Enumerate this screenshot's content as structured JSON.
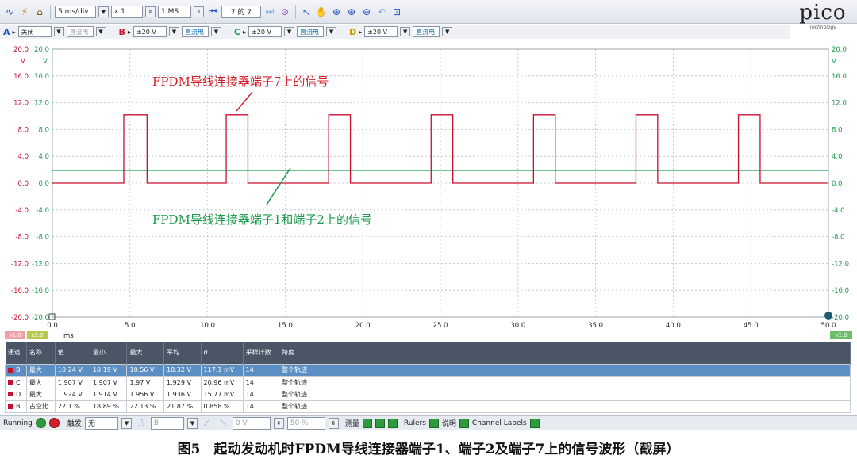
{
  "toolbar": {
    "timebase": "5 ms/div",
    "zoom": "x 1",
    "samples": "1 MS",
    "capture": "7 的 7"
  },
  "logo": {
    "text": "pico",
    "sub": "Technology"
  },
  "channels": [
    {
      "letter": "A",
      "range": "关闭",
      "coupling": "直流电",
      "enabled": false,
      "color": "#1f4fbf"
    },
    {
      "letter": "B",
      "range": "±20 V",
      "coupling": "直流电",
      "enabled": true,
      "color": "#c8102e"
    },
    {
      "letter": "C",
      "range": "±20 V",
      "coupling": "直流电",
      "enabled": true,
      "color": "#1a9a4a"
    },
    {
      "letter": "D",
      "range": "±20 V",
      "coupling": "直流电",
      "enabled": true,
      "color": "#c9a000"
    }
  ],
  "chart_data": {
    "type": "line",
    "xlabel": "ms",
    "xlim": [
      0,
      50
    ],
    "ylim": [
      -20,
      20
    ],
    "yunit": "V",
    "xticks": [
      "0.0",
      "5.0",
      "10.0",
      "15.0",
      "20.0",
      "25.0",
      "30.0",
      "35.0",
      "40.0",
      "45.0",
      "50.0"
    ],
    "yticks": [
      "20.0",
      "16.0",
      "12.0",
      "8.0",
      "4.0",
      "0.0",
      "-4.0",
      "-8.0",
      "-12.0",
      "-16.0",
      "-20.0"
    ],
    "series": [
      {
        "color": "#c8102e",
        "pulses_ms": [
          [
            4.6,
            6.1
          ],
          [
            11.2,
            12.6
          ],
          [
            17.8,
            19.2
          ],
          [
            24.4,
            25.8
          ],
          [
            31.0,
            32.4
          ],
          [
            37.6,
            39.0
          ],
          [
            44.2,
            45.6
          ]
        ],
        "low_v": 0.0,
        "high_v": 10.2
      },
      {
        "color": "#1a9a4a",
        "level_v": 1.9
      }
    ],
    "annotations": [
      {
        "text": "FPDM导线连接器端子7上的信号",
        "color": "#d0202a"
      },
      {
        "text": "FPDM导线连接器端子1和端子2上的信号",
        "color": "#1a9a4a"
      }
    ],
    "scale_left": [
      "x1.0",
      "x1.0"
    ],
    "scale_right": "x1.0"
  },
  "table": {
    "headers": [
      "通道",
      "名称",
      "值",
      "最小",
      "最大",
      "平均",
      "σ",
      "采样计数",
      "跨度"
    ],
    "rows": [
      [
        "B",
        "最大",
        "10.24 V",
        "10.19 V",
        "10.56 V",
        "10.32 V",
        "117.1 mV",
        "14",
        "整个轨迹"
      ],
      [
        "C",
        "最大",
        "1.907 V",
        "1.907 V",
        "1.97 V",
        "1.929 V",
        "20.96 mV",
        "14",
        "整个轨迹"
      ],
      [
        "D",
        "最大",
        "1.924 V",
        "1.914 V",
        "1.956 V",
        "1.936 V",
        "15.77 mV",
        "14",
        "整个轨迹"
      ],
      [
        "B",
        "占空比",
        "22.1 %",
        "18.89 %",
        "22.13 %",
        "21.87 %",
        "0.858 %",
        "14",
        "整个轨迹"
      ]
    ]
  },
  "status": {
    "running": "Running",
    "trigger_label": "触发",
    "trigger_mode": "无",
    "trigger_channel": "B",
    "threshold": "0 V",
    "pretrigger": "50 %",
    "measure": "测量",
    "rulers": "Rulers",
    "notes": "说明",
    "channel_labels": "Channel Labels"
  },
  "caption": "图5　起动发动机时FPDM导线连接器端子1、端子2及端子7上的信号波形（截屏）"
}
